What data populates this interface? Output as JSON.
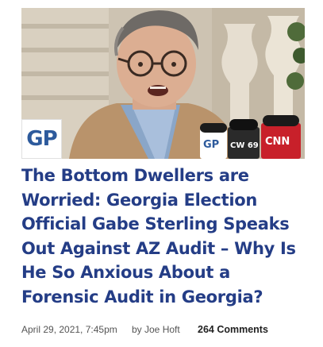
{
  "article": {
    "badge": "GP",
    "headline": "The Bottom Dwellers are Worried: Georgia Election Official Gabe Sterling Speaks Out Against AZ Audit – Why Is He So Anxious About a Forensic Audit in Georgia?",
    "date": "April 29, 2021, 7:45pm",
    "author": "by Joe Hoft",
    "comments": "264 Comments"
  },
  "microphones": {
    "mic1": "GP",
    "mic2": "CW 69",
    "mic3": "CNN"
  }
}
